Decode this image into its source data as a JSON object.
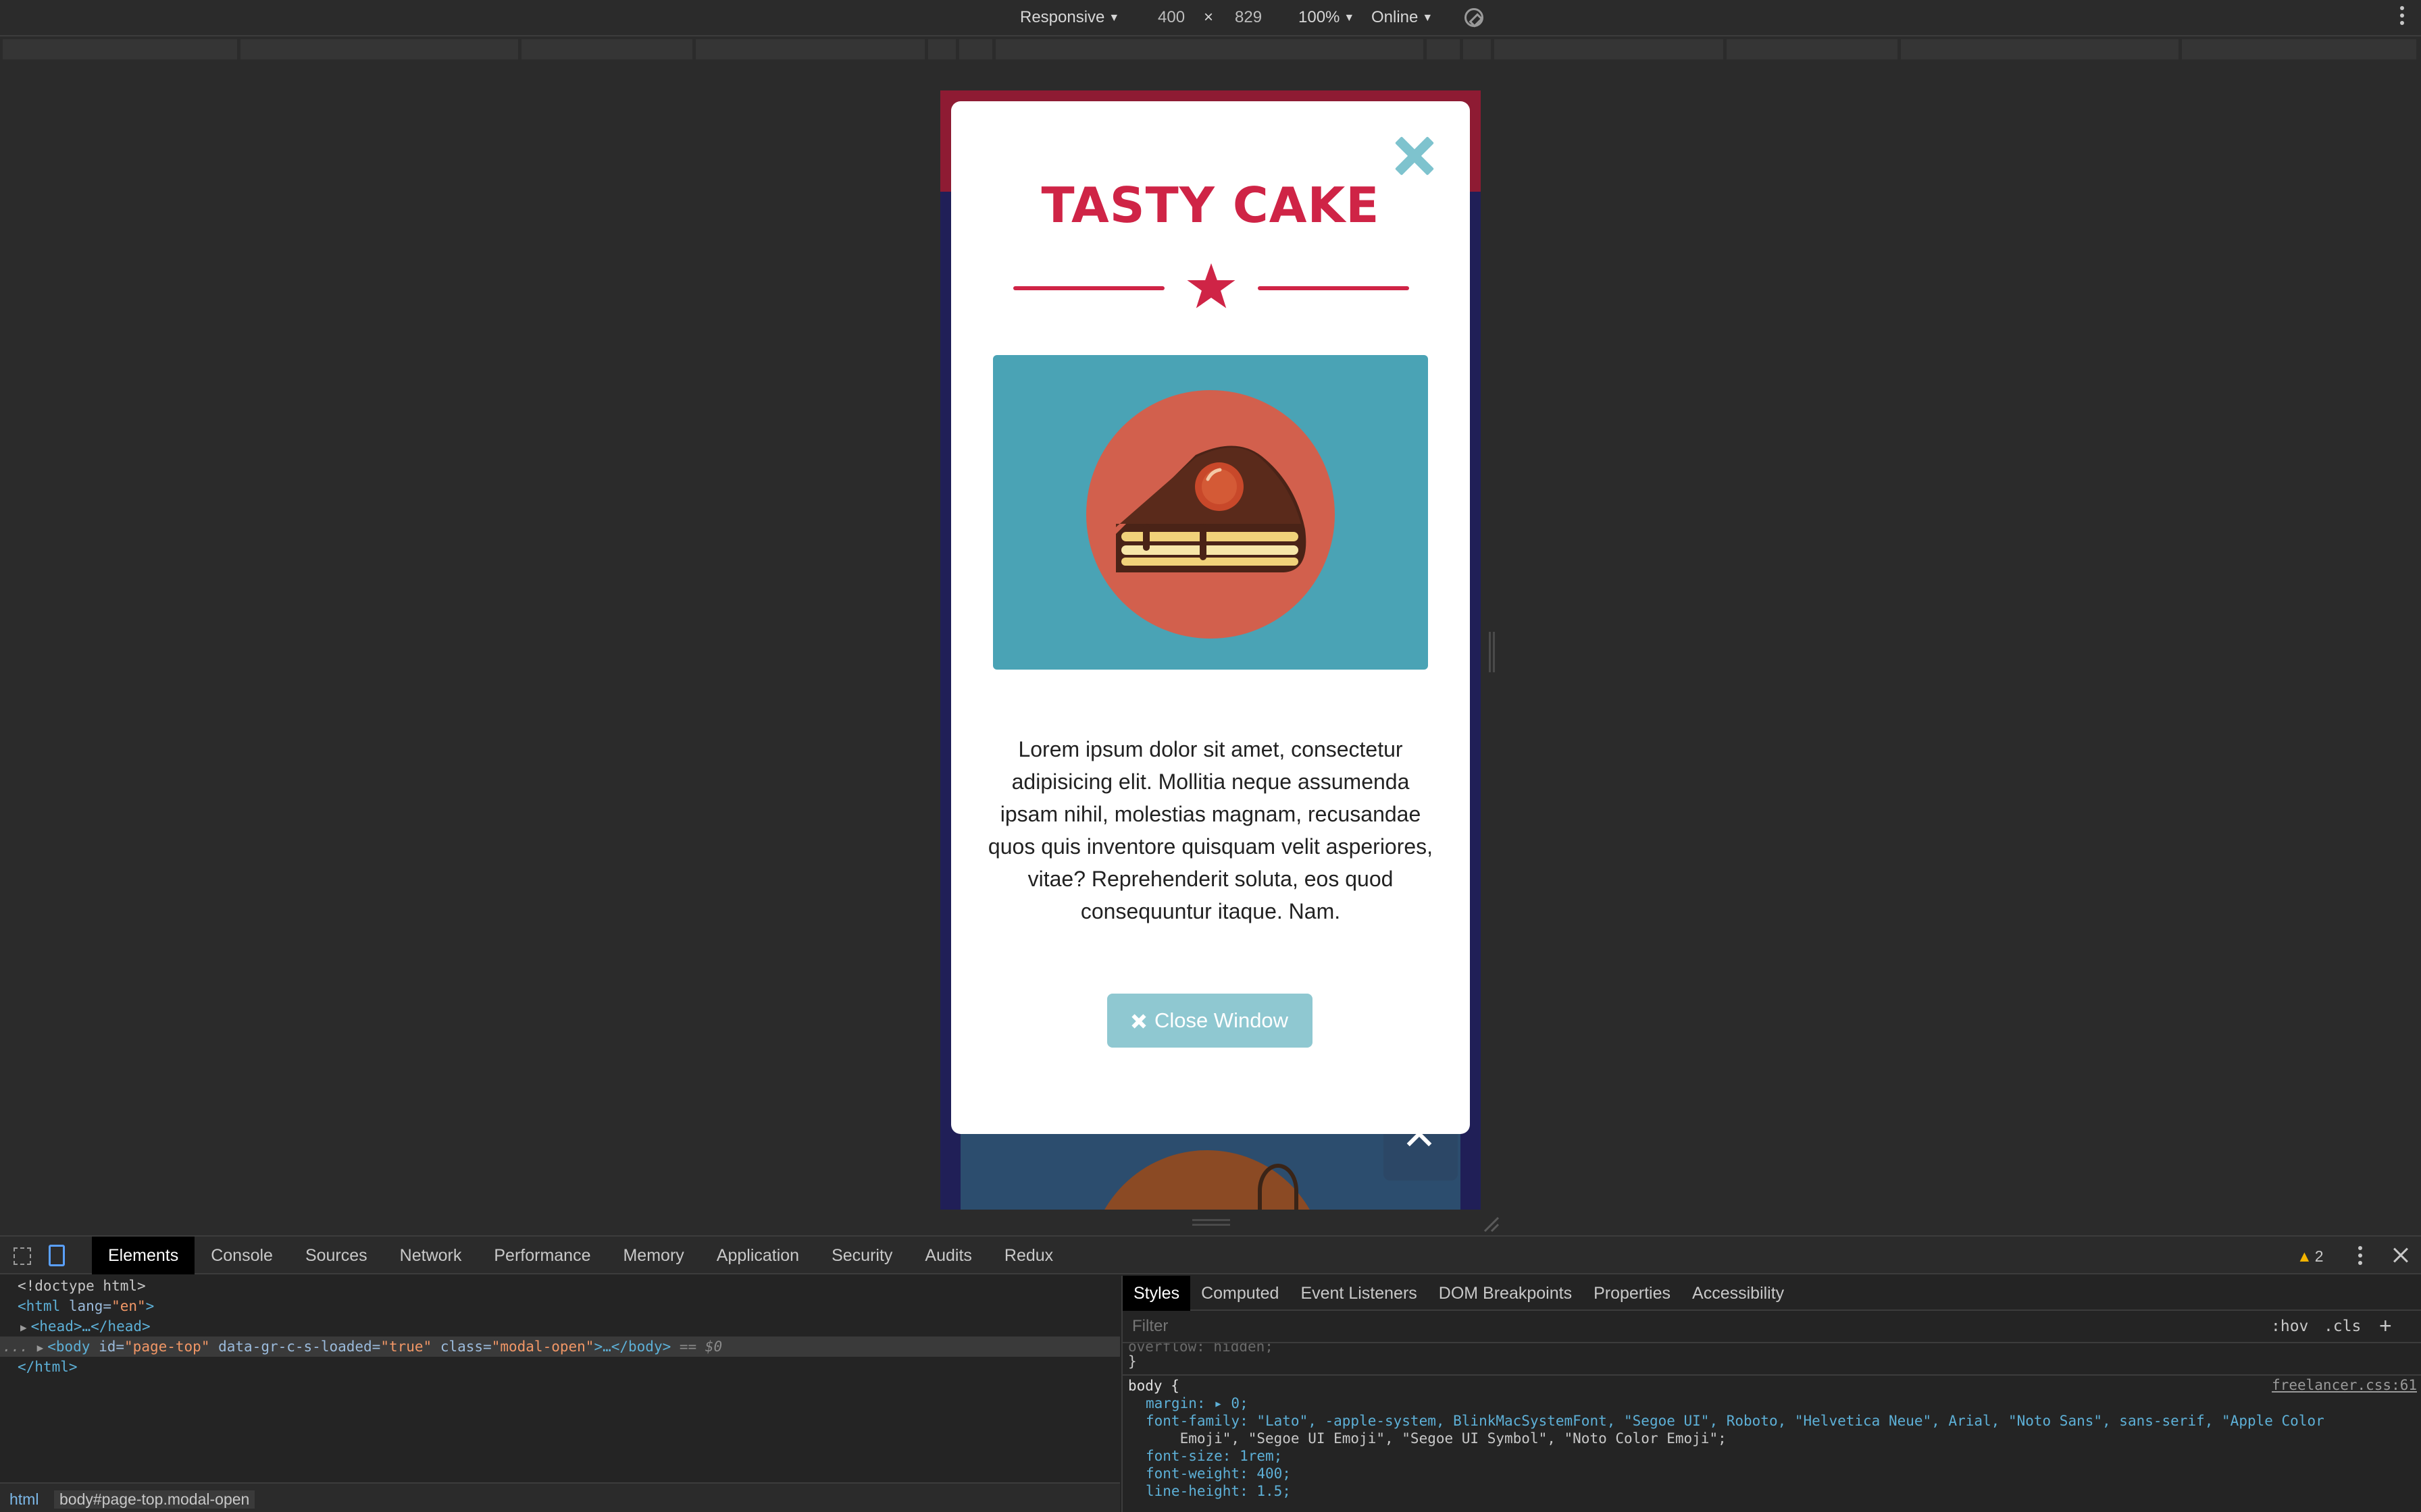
{
  "device_toolbar": {
    "device": "Responsive",
    "width": "400",
    "times": "×",
    "height": "829",
    "zoom": "100%",
    "network": "Online"
  },
  "modal": {
    "title": "TASTY CAKE",
    "body": "Lorem ipsum dolor sit amet, consectetur adipisicing elit. Mollitia neque assumenda ipsam nihil, molestias magnam, recusandae quos quis inventore quisquam velit asperiores, vitae? Reprehenderit soluta, eos quod consequuntur itaque. Nam.",
    "close_button_label": "Close Window",
    "colors": {
      "accent": "#cf2446",
      "panel": "#4aa3b5",
      "button": "#8fc8d1",
      "plate": "#d2604d"
    }
  },
  "devtools": {
    "tabs": [
      "Elements",
      "Console",
      "Sources",
      "Network",
      "Performance",
      "Memory",
      "Application",
      "Security",
      "Audits",
      "Redux"
    ],
    "warning_count": "2",
    "elements": {
      "doctype": "<!doctype html>",
      "html_open_tag": "<html",
      "html_lang_attr": " lang=",
      "html_lang_val": "\"en\"",
      "html_open_end": ">",
      "head_tag": "<head>…</head>",
      "body_prefix": "...",
      "body_open": "<body",
      "body_id_attr": " id=",
      "body_id_val": "\"page-top\"",
      "body_data_attr": " data-gr-c-s-loaded=",
      "body_data_val": "\"true\"",
      "body_class_attr": " class=",
      "body_class_val": "\"modal-open\"",
      "body_close": ">…</body>",
      "selected_marker": " == $0",
      "html_close": "</html>"
    },
    "breadcrumbs": [
      "html",
      "body#page-top.modal-open"
    ],
    "styles": {
      "tabs": [
        "Styles",
        "Computed",
        "Event Listeners",
        "DOM Breakpoints",
        "Properties",
        "Accessibility"
      ],
      "filter_placeholder": "Filter",
      "hov": ":hov",
      "cls": ".cls",
      "add": "+",
      "prev_rule_fragment": "overflow: hidden;",
      "prev_rule_close": "}",
      "selector": "body {",
      "source": "freelancer.css:61",
      "declarations": [
        "margin: ▸ 0;",
        "font-family: \"Lato\", -apple-system, BlinkMacSystemFont, \"Segoe UI\", Roboto, \"Helvetica Neue\", Arial, \"Noto Sans\", sans-serif, \"Apple Color",
        "    Emoji\", \"Segoe UI Emoji\", \"Segoe UI Symbol\", \"Noto Color Emoji\";",
        "font-size: 1rem;",
        "font-weight: 400;",
        "line-height: 1.5;"
      ]
    }
  }
}
